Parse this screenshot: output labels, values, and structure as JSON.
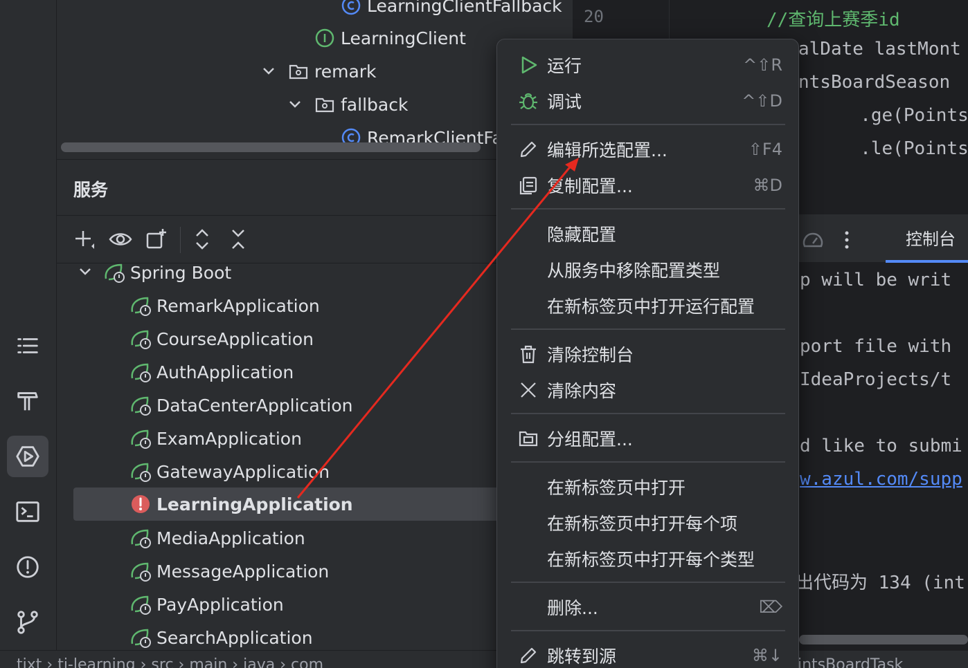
{
  "project_tree": {
    "items": [
      {
        "label": "LearningClientFallback",
        "kind": "class"
      },
      {
        "label": "LearningClient",
        "kind": "interface"
      },
      {
        "label": "remark",
        "kind": "package"
      },
      {
        "label": "fallback",
        "kind": "package"
      },
      {
        "label": "RemarkClientFa",
        "kind": "class"
      }
    ]
  },
  "editor": {
    "line_number": "20",
    "lines": [
      "//查询上赛季id",
      "alDate lastMont",
      "ntsBoardSeason",
      "        .ge(Points",
      "        .le(Points"
    ]
  },
  "services": {
    "title": "服务",
    "group": "Spring Boot",
    "apps": [
      {
        "label": "RemarkApplication",
        "status": "normal"
      },
      {
        "label": "CourseApplication",
        "status": "normal"
      },
      {
        "label": "AuthApplication",
        "status": "normal"
      },
      {
        "label": "DataCenterApplication",
        "status": "normal"
      },
      {
        "label": "ExamApplication",
        "status": "normal"
      },
      {
        "label": "GatewayApplication",
        "status": "normal"
      },
      {
        "label": "LearningApplication",
        "status": "error"
      },
      {
        "label": "MediaApplication",
        "status": "normal"
      },
      {
        "label": "MessageApplication",
        "status": "normal"
      },
      {
        "label": "PayApplication",
        "status": "normal"
      },
      {
        "label": "SearchApplication",
        "status": "normal"
      }
    ]
  },
  "console": {
    "tab_label": "控制台",
    "lines": [
      "p will be writ",
      "",
      "port file with",
      "IdeaProjects/t",
      "",
      "d like to submi",
      "w.azul.com/supp",
      "",
      "",
      "出代码为 134 (int"
    ]
  },
  "status_bar": {
    "breadcrumb": [
      "tjxt",
      "tj-learning",
      "src",
      "main",
      "java",
      "com"
    ],
    "right_text": "intsBoardTask"
  },
  "context_menu": {
    "items": [
      {
        "label": "运行",
        "shortcut": "^⇧R",
        "icon": "run-icon"
      },
      {
        "label": "调试",
        "shortcut": "^⇧D",
        "icon": "debug-icon"
      },
      {
        "label": "编辑所选配置...",
        "shortcut": "⇧F4",
        "icon": "pencil-icon"
      },
      {
        "label": "复制配置...",
        "shortcut": "⌘D",
        "icon": "copy-icon"
      },
      {
        "label": "隐藏配置",
        "shortcut": "",
        "icon": ""
      },
      {
        "label": "从服务中移除配置类型",
        "shortcut": "",
        "icon": ""
      },
      {
        "label": "在新标签页中打开运行配置",
        "shortcut": "",
        "icon": ""
      },
      {
        "label": "清除控制台",
        "shortcut": "",
        "icon": "trash-icon"
      },
      {
        "label": "清除内容",
        "shortcut": "",
        "icon": "close-icon"
      },
      {
        "label": "分组配置...",
        "shortcut": "",
        "icon": "folder-icon"
      },
      {
        "label": "在新标签页中打开",
        "shortcut": "",
        "icon": ""
      },
      {
        "label": "在新标签页中打开每个项",
        "shortcut": "",
        "icon": ""
      },
      {
        "label": "在新标签页中打开每个类型",
        "shortcut": "",
        "icon": ""
      },
      {
        "label": "删除...",
        "shortcut": "⌦",
        "icon": ""
      },
      {
        "label": "跳转到源",
        "shortcut": "⌘↓",
        "icon": "pencil-icon"
      }
    ]
  },
  "colors": {
    "accent": "#548af7",
    "spring_green": "#5fb86f",
    "error_red": "#db5c5c",
    "annotation_arrow": "#e5291f"
  }
}
